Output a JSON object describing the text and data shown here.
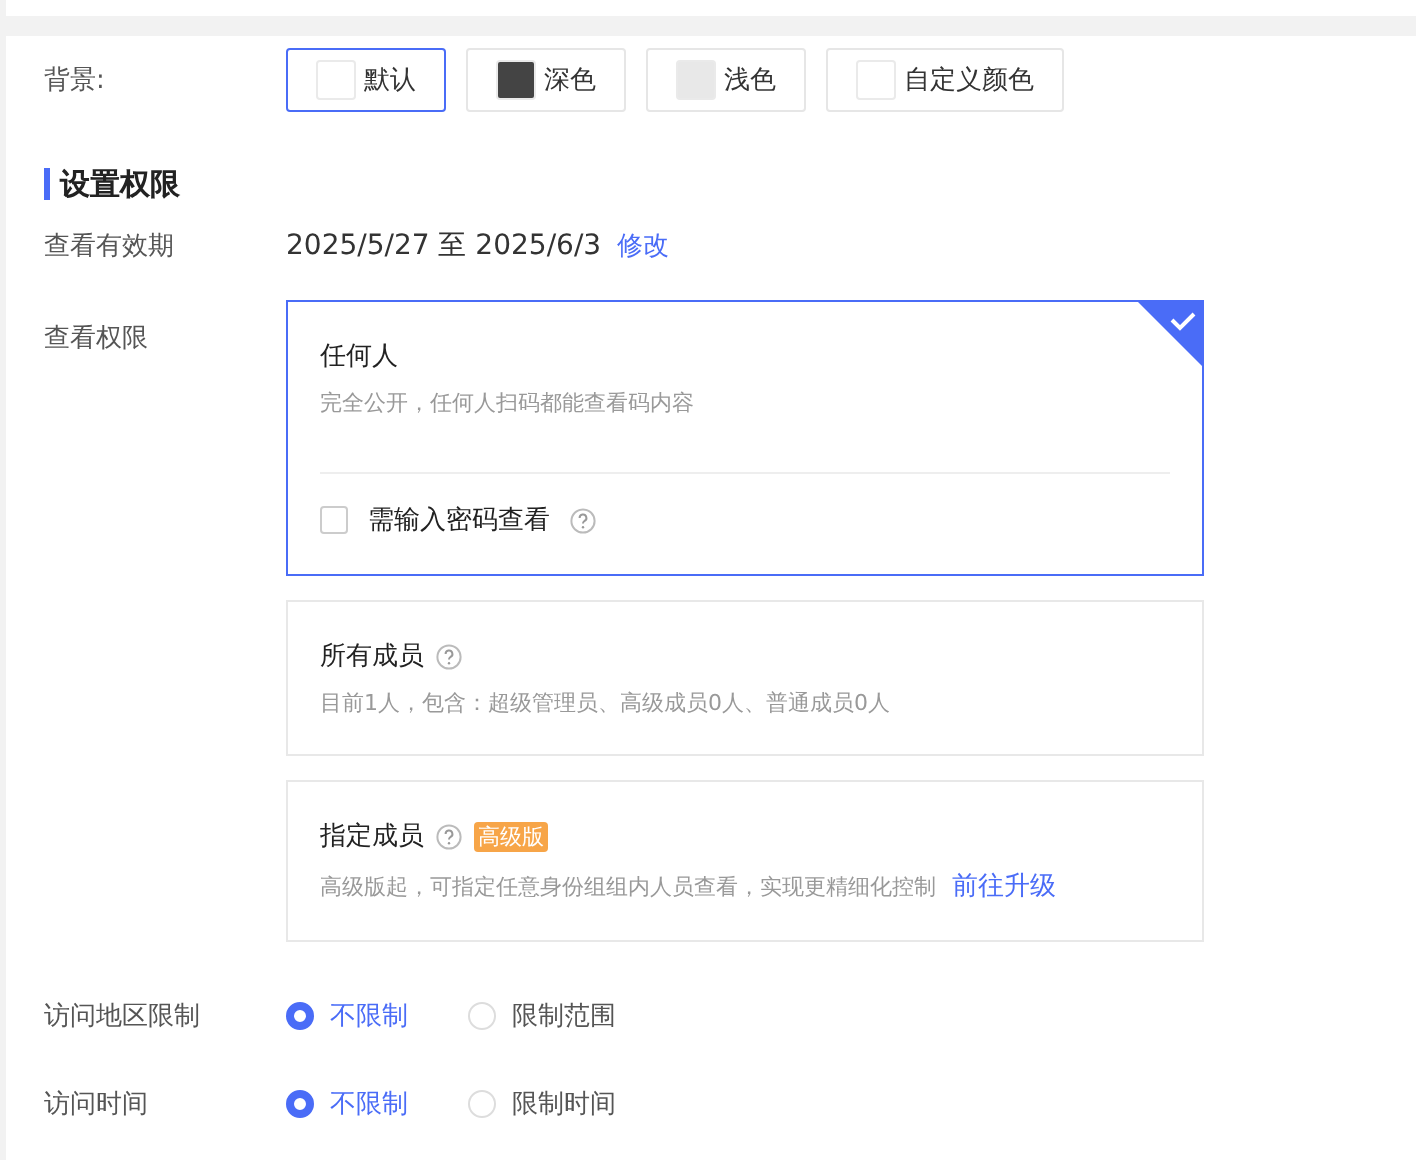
{
  "background": {
    "label": "背景:",
    "options": [
      {
        "label": "默认",
        "color": "#ffffff",
        "selected": true
      },
      {
        "label": "深色",
        "color": "#444444",
        "selected": false
      },
      {
        "label": "浅色",
        "color": "#e8e8e8",
        "selected": false
      },
      {
        "label": "自定义颜色",
        "color": "#ffffff",
        "selected": false
      }
    ]
  },
  "section": {
    "title": "设置权限"
  },
  "validity": {
    "label": "查看有效期",
    "value": "2025/5/27 至 2025/6/3",
    "link": "修改"
  },
  "permission": {
    "label": "查看权限",
    "options": [
      {
        "title": "任何人",
        "help": false,
        "description": "完全公开，任何人扫码都能查看码内容",
        "selected": true,
        "password": {
          "label": "需输入密码查看",
          "checked": false
        }
      },
      {
        "title": "所有成员",
        "help": true,
        "description": "目前1人，包含：超级管理员、高级成员0人、普通成员0人",
        "selected": false
      },
      {
        "title": "指定成员",
        "help": true,
        "badge": "高级版",
        "description": "高级版起，可指定任意身份组组内人员查看，实现更精细化控制",
        "link": "前往升级",
        "selected": false
      }
    ]
  },
  "radio_rows": [
    {
      "label": "访问地区限制",
      "options": [
        {
          "label": "不限制",
          "selected": true
        },
        {
          "label": "限制范围",
          "selected": false
        }
      ]
    },
    {
      "label": "访问时间",
      "options": [
        {
          "label": "不限制",
          "selected": true
        },
        {
          "label": "限制时间",
          "selected": false
        }
      ]
    }
  ]
}
